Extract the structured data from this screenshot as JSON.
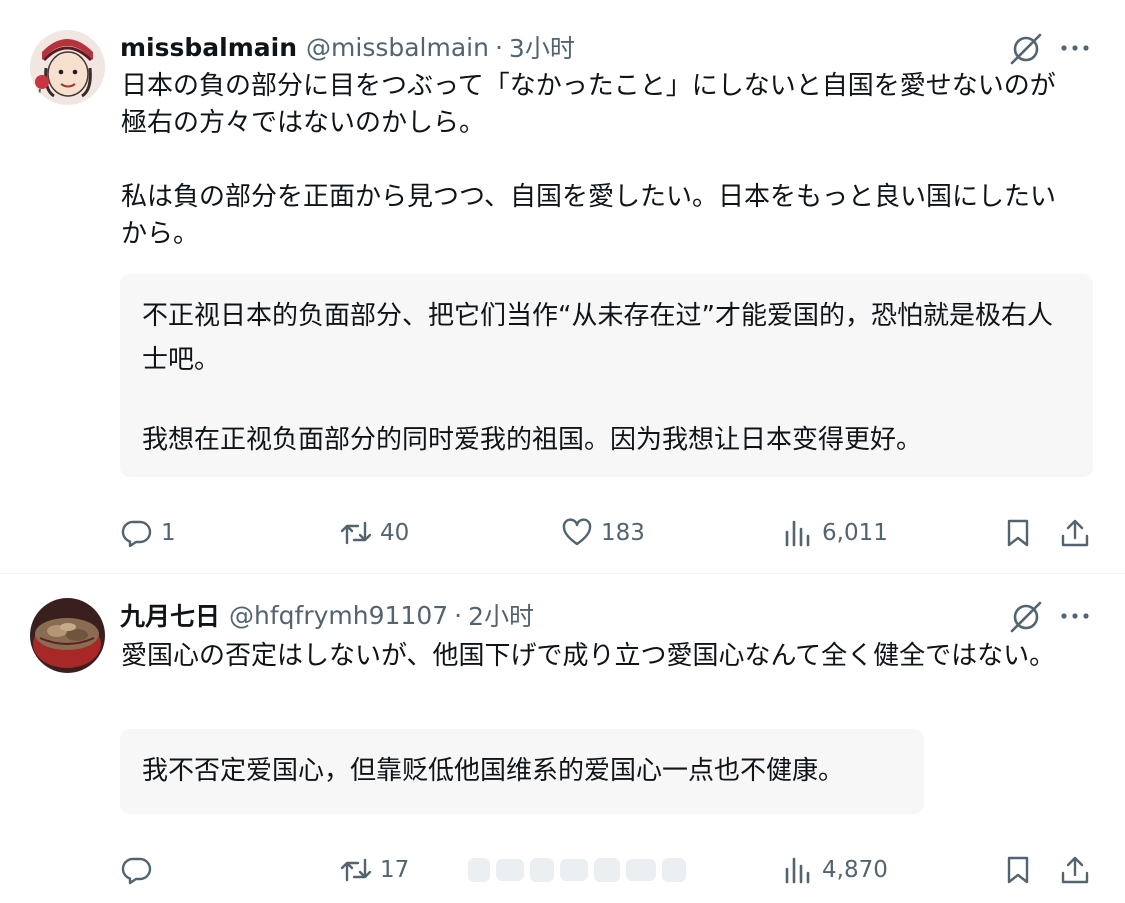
{
  "tweets": [
    {
      "display_name": "missbalmain",
      "handle": "@missbalmain",
      "separator": "·",
      "time": "3小时",
      "body": [
        "日本の負の部分に目をつぶって「なかったこと」にしないと自国を愛せないのが極右の方々ではないのかしら。",
        "私は負の部分を正面から見つつ、自国を愛したい。日本をもっと良い国にしたいから。"
      ],
      "translation": [
        "不正视日本的负面部分、把它们当作“从未存在过”才能爱国的，恐怕就是极右人士吧。",
        "我想在正视负面部分的同时爱我的祖国。因为我想让日本变得更好。"
      ],
      "stats": {
        "replies": "1",
        "retweets": "40",
        "likes": "183",
        "views": "6,011"
      }
    },
    {
      "display_name": "九月七日",
      "handle": "@hfqfrymh91107",
      "separator": "·",
      "time": "2小时",
      "body": [
        "愛国心の否定はしないが、他国下げで成り立つ愛国心なんて全く健全ではない。"
      ],
      "translation": [
        "我不否定爱国心，但靠贬低他国维系的爱国心一点也不健康。"
      ],
      "stats": {
        "retweets": "17",
        "views": "4,870"
      }
    }
  ],
  "icons": {
    "reply": "reply-icon",
    "retweet": "retweet-icon",
    "like": "heart-icon",
    "views": "views-icon",
    "bookmark": "bookmark-icon",
    "share": "share-icon",
    "grok": "grok-icon",
    "more": "more-icon"
  },
  "colors": {
    "text": "#0f1419",
    "secondary": "#536471",
    "translation_bg": "#f7f7f7"
  }
}
